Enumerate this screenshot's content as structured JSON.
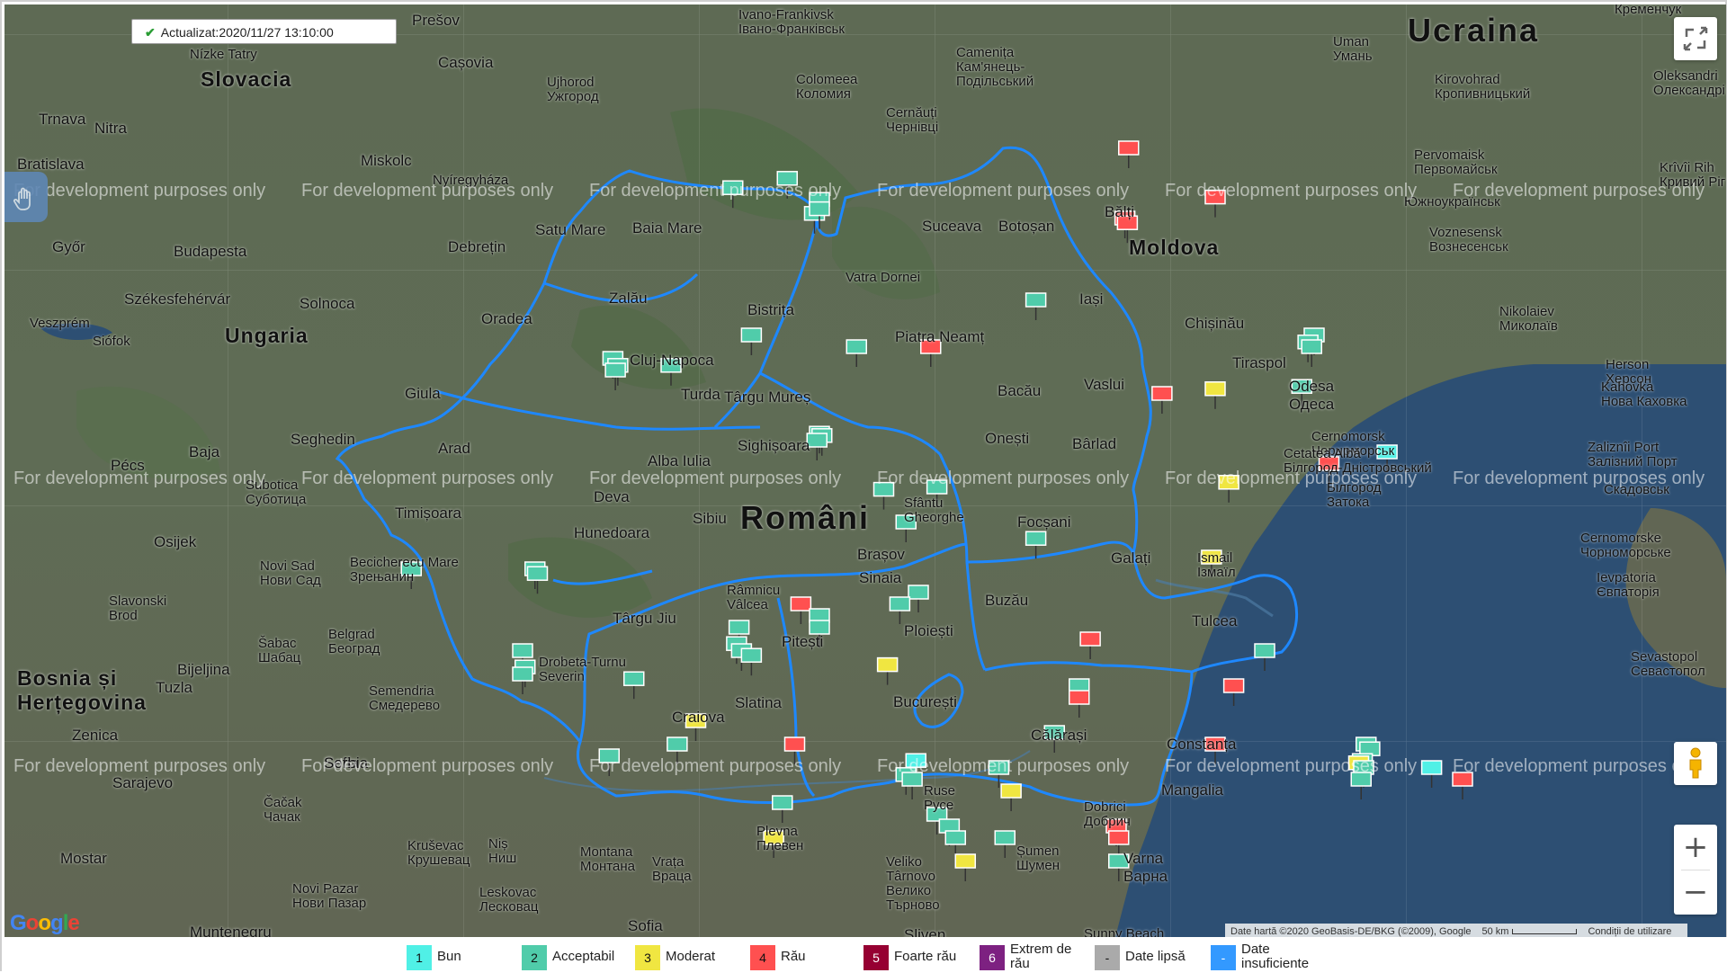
{
  "status": {
    "updated_label": "Actualizat:2020/11/27 13:10:00"
  },
  "watermark": "For development purposes only",
  "map": {
    "countries": [
      {
        "id": "ucraina",
        "name": "Ucraina"
      },
      {
        "id": "slovacia",
        "name": "Slovacia"
      },
      {
        "id": "moldova",
        "name": "Moldova"
      },
      {
        "id": "ungaria",
        "name": "Ungaria"
      },
      {
        "id": "romania",
        "name": "Români"
      },
      {
        "id": "bosnia",
        "name": "Bosnia și Herțegovina"
      },
      {
        "id": "sofia",
        "name": "Sofia"
      }
    ],
    "cities": [
      {
        "id": "presov",
        "name": "Prešov"
      },
      {
        "id": "ivano",
        "name": "Ivano-Frankivsk\nІвано-Франківськ"
      },
      {
        "id": "kremenciuc",
        "name": "Кременчук"
      },
      {
        "id": "uman",
        "name": "Uman\nУмань"
      },
      {
        "id": "nizke",
        "name": "Nízke Tatry"
      },
      {
        "id": "kosice",
        "name": "Cașovia"
      },
      {
        "id": "ujhorod",
        "name": "Ujhorod\nУжгород"
      },
      {
        "id": "colomeea",
        "name": "Colomeea\nКоломия"
      },
      {
        "id": "camenita",
        "name": "Camenița\nКам'янець-\nПодільський"
      },
      {
        "id": "kirovohrad",
        "name": "Kirovohrad\nКропивницький"
      },
      {
        "id": "oleksandria",
        "name": "Oleksandri\nОлександрі"
      },
      {
        "id": "trnava",
        "name": "Trnava"
      },
      {
        "id": "nitra",
        "name": "Nitra"
      },
      {
        "id": "bratislava",
        "name": "Bratislava"
      },
      {
        "id": "miskolc",
        "name": "Miskolc"
      },
      {
        "id": "nagyeszes",
        "name": "Nyíregyháza"
      },
      {
        "id": "cernauti",
        "name": "Cernăuți\nЧернівці"
      },
      {
        "id": "pervomaisk",
        "name": "Pervomaisk\nПервомайськ"
      },
      {
        "id": "kryvyi",
        "name": "Krîvîi Rih\nКривий Ріг"
      },
      {
        "id": "gyor",
        "name": "Győr"
      },
      {
        "id": "budapesta",
        "name": "Budapesta"
      },
      {
        "id": "debretin",
        "name": "Debrețin"
      },
      {
        "id": "satumare",
        "name": "Satu Mare"
      },
      {
        "id": "baiamare",
        "name": "Baia Mare"
      },
      {
        "id": "suceava",
        "name": "Suceava"
      },
      {
        "id": "botosan",
        "name": "Botoșan"
      },
      {
        "id": "balti",
        "name": "Bălți"
      },
      {
        "id": "iuzhnouk",
        "name": "Южноукраїнськ"
      },
      {
        "id": "voznesensk",
        "name": "Voznesensk\nВознесенськ"
      },
      {
        "id": "szekes",
        "name": "Székesfehérvár"
      },
      {
        "id": "solnoca",
        "name": "Solnoca"
      },
      {
        "id": "oradea",
        "name": "Oradea"
      },
      {
        "id": "zalau",
        "name": "Zalău"
      },
      {
        "id": "bistrita",
        "name": "Bistrița"
      },
      {
        "id": "vatra",
        "name": "Vatra Dornei"
      },
      {
        "id": "piatra",
        "name": "Piatra Neamț"
      },
      {
        "id": "iasi",
        "name": "Iași"
      },
      {
        "id": "chisinau",
        "name": "Chișinău"
      },
      {
        "id": "nikolaiev",
        "name": "Nikolaiev\nМиколаїв"
      },
      {
        "id": "veszprem",
        "name": "Veszprém"
      },
      {
        "id": "siofok",
        "name": "Siófok"
      },
      {
        "id": "cluj",
        "name": "Cluj-Napoca"
      },
      {
        "id": "targumures",
        "name": "Târgu Mureș"
      },
      {
        "id": "turda",
        "name": "Turda"
      },
      {
        "id": "bacau",
        "name": "Bacău"
      },
      {
        "id": "vaslui",
        "name": "Vaslui"
      },
      {
        "id": "tiraspol",
        "name": "Tiraspol"
      },
      {
        "id": "herson",
        "name": "Herson\nХерсон"
      },
      {
        "id": "kahovka",
        "name": "Kahovka\nНова Каховка"
      },
      {
        "id": "szeged",
        "name": "Seghedin"
      },
      {
        "id": "giula",
        "name": "Giula"
      },
      {
        "id": "baja",
        "name": "Baja"
      },
      {
        "id": "odesa",
        "name": "Odesa\nОдеса"
      },
      {
        "id": "cernomorsk",
        "name": "Cernomorsk\nЧорноморськ"
      },
      {
        "id": "onesti",
        "name": "Onești"
      },
      {
        "id": "barlad",
        "name": "Bârlad"
      },
      {
        "id": "pecs",
        "name": "Pécs"
      },
      {
        "id": "subotica",
        "name": "Subotica\nСуботица"
      },
      {
        "id": "arad",
        "name": "Arad"
      },
      {
        "id": "alba",
        "name": "Alba Iulia"
      },
      {
        "id": "sighisoara",
        "name": "Sighișoara"
      },
      {
        "id": "cetatea",
        "name": "Cetatea Albă\nБілгород-Дністровський"
      },
      {
        "id": "zaliznyi",
        "name": "Zaliznîi Port\nЗалізний Порт"
      },
      {
        "id": "skadovsk",
        "name": "Скадовськ"
      },
      {
        "id": "timisoara",
        "name": "Timișoara"
      },
      {
        "id": "deva",
        "name": "Deva"
      },
      {
        "id": "sibiu",
        "name": "Sibiu"
      },
      {
        "id": "sfantu",
        "name": "Sfântu\nGheorghe"
      },
      {
        "id": "focsani",
        "name": "Focșani"
      },
      {
        "id": "bilhorod",
        "name": "Білгород\nЗатока"
      },
      {
        "id": "osijek",
        "name": "Osijek"
      },
      {
        "id": "hunedoara",
        "name": "Hunedoara"
      },
      {
        "id": "brasov",
        "name": "Brașov"
      },
      {
        "id": "galati",
        "name": "Galați"
      },
      {
        "id": "izmail",
        "name": "Ismail\nІзмаїл"
      },
      {
        "id": "cernomorske",
        "name": "Cernomorske\nЧорноморське"
      },
      {
        "id": "novisad",
        "name": "Novi Sad\nНови Сад"
      },
      {
        "id": "zrenjanin",
        "name": "Becicherecu Mare\nЗрењанин"
      },
      {
        "id": "sinaia",
        "name": "Sinaia"
      },
      {
        "id": "ramnicu",
        "name": "Râmnicu\nVâlcea"
      },
      {
        "id": "buzau",
        "name": "Buzău"
      },
      {
        "id": "tulcea",
        "name": "Tulcea"
      },
      {
        "id": "evpatoria",
        "name": "Ievpatoria\nЄвпаторія"
      },
      {
        "id": "slavonski",
        "name": "Slavonski\nBrod"
      },
      {
        "id": "targujiu",
        "name": "Târgu Jiu"
      },
      {
        "id": "pitesti",
        "name": "Pitești"
      },
      {
        "id": "ploiesti",
        "name": "Ploiești"
      },
      {
        "id": "sabac",
        "name": "Šabac\nШабац"
      },
      {
        "id": "belgrad",
        "name": "Belgrad\nБеоград"
      },
      {
        "id": "drobeta",
        "name": "Drobeta-Turnu\nSeverin"
      },
      {
        "id": "sevastopol",
        "name": "Sevastopol\nСевастопол"
      },
      {
        "id": "bijeljina",
        "name": "Bijeljina"
      },
      {
        "id": "tuzla",
        "name": "Tuzla"
      },
      {
        "id": "craiova",
        "name": "Craiova"
      },
      {
        "id": "slatina",
        "name": "Slatina"
      },
      {
        "id": "bucuresti",
        "name": "București"
      },
      {
        "id": "calarasi",
        "name": "Călărași"
      },
      {
        "id": "constanta",
        "name": "Constanța"
      },
      {
        "id": "smederevo",
        "name": "Semendria\nСмедерево"
      },
      {
        "id": "zenica",
        "name": "Zenica"
      },
      {
        "id": "sarajevo",
        "name": "Sarajevo"
      },
      {
        "id": "sofia",
        "name": "Serbia"
      },
      {
        "id": "cacak",
        "name": "Čačak\nЧачак"
      },
      {
        "id": "ruse",
        "name": "Ruse\nРусе"
      },
      {
        "id": "mangalia",
        "name": "Mangalia"
      },
      {
        "id": "dobrich",
        "name": "Dobrici\nДобрич"
      },
      {
        "id": "pleven",
        "name": "Plevna\nПлевен"
      },
      {
        "id": "krusevac",
        "name": "Kruševac\nКрушевац"
      },
      {
        "id": "nis",
        "name": "Niș\nНиш"
      },
      {
        "id": "montana",
        "name": "Montana\nМонтана"
      },
      {
        "id": "vratsa",
        "name": "Vrața\nВраца"
      },
      {
        "id": "tarnovo",
        "name": "Veliko\nTârnovo\nВелико\nТърново"
      },
      {
        "id": "shumen",
        "name": "Șumen\nШумен"
      },
      {
        "id": "varna",
        "name": "Varna\nВарна"
      },
      {
        "id": "mostar",
        "name": "Mostar"
      },
      {
        "id": "novipazar",
        "name": "Novi Pazar\nНови Пазар"
      },
      {
        "id": "leskovac",
        "name": "Leskovac\nЛесковац"
      },
      {
        "id": "sofia2",
        "name": "Sofia"
      },
      {
        "id": "muntenegru",
        "name": "Muntenegru"
      },
      {
        "id": "sliven",
        "name": "Sliven"
      },
      {
        "id": "sunnybeach",
        "name": "Sunny Beach"
      }
    ],
    "stations": [
      {
        "q": 2,
        "lat": 47.83,
        "lon": 22.9
      },
      {
        "q": 2,
        "lat": 47.87,
        "lon": 23.34
      },
      {
        "q": 2,
        "lat": 47.78,
        "lon": 23.6
      },
      {
        "q": 2,
        "lat": 47.72,
        "lon": 23.56
      },
      {
        "q": 2,
        "lat": 47.74,
        "lon": 23.6
      },
      {
        "q": 4,
        "lat": 48.0,
        "lon": 26.1
      },
      {
        "q": 4,
        "lat": 47.79,
        "lon": 26.8
      },
      {
        "q": 4,
        "lat": 47.7,
        "lon": 26.07
      },
      {
        "q": 4,
        "lat": 47.68,
        "lon": 26.09
      },
      {
        "q": 2,
        "lat": 47.35,
        "lon": 25.35
      },
      {
        "q": 2,
        "lat": 47.2,
        "lon": 27.6
      },
      {
        "q": 2,
        "lat": 47.17,
        "lon": 27.55
      },
      {
        "q": 2,
        "lat": 47.15,
        "lon": 27.58
      },
      {
        "q": 2,
        "lat": 47.1,
        "lon": 21.93
      },
      {
        "q": 2,
        "lat": 47.07,
        "lon": 21.97
      },
      {
        "q": 2,
        "lat": 47.05,
        "lon": 21.95
      },
      {
        "q": 2,
        "lat": 47.07,
        "lon": 22.4
      },
      {
        "q": 2,
        "lat": 47.2,
        "lon": 23.05
      },
      {
        "q": 2,
        "lat": 47.15,
        "lon": 23.9
      },
      {
        "q": 4,
        "lat": 47.15,
        "lon": 24.5
      },
      {
        "q": 4,
        "lat": 46.95,
        "lon": 26.37
      },
      {
        "q": 3,
        "lat": 46.97,
        "lon": 26.8
      },
      {
        "q": 2,
        "lat": 46.98,
        "lon": 27.5
      },
      {
        "q": 2,
        "lat": 46.78,
        "lon": 23.6
      },
      {
        "q": 2,
        "lat": 46.77,
        "lon": 23.62
      },
      {
        "q": 2,
        "lat": 46.75,
        "lon": 23.58
      },
      {
        "q": 4,
        "lat": 46.65,
        "lon": 27.72
      },
      {
        "q": 1,
        "lat": 46.7,
        "lon": 28.19
      },
      {
        "q": 3,
        "lat": 46.57,
        "lon": 26.91
      },
      {
        "q": 2,
        "lat": 46.55,
        "lon": 24.55
      },
      {
        "q": 2,
        "lat": 46.54,
        "lon": 24.12
      },
      {
        "q": 2,
        "lat": 46.4,
        "lon": 24.3
      },
      {
        "q": 2,
        "lat": 46.33,
        "lon": 25.35
      },
      {
        "q": 3,
        "lat": 46.25,
        "lon": 26.77
      },
      {
        "q": 2,
        "lat": 46.2,
        "lon": 21.3
      },
      {
        "q": 2,
        "lat": 46.18,
        "lon": 21.32
      },
      {
        "q": 2,
        "lat": 46.2,
        "lon": 20.3
      },
      {
        "q": 2,
        "lat": 46.1,
        "lon": 24.4
      },
      {
        "q": 2,
        "lat": 46.05,
        "lon": 24.25
      },
      {
        "q": 4,
        "lat": 46.05,
        "lon": 23.45
      },
      {
        "q": 2,
        "lat": 46.0,
        "lon": 23.6
      },
      {
        "q": 2,
        "lat": 45.95,
        "lon": 23.6
      },
      {
        "q": 2,
        "lat": 45.95,
        "lon": 22.95
      },
      {
        "q": 2,
        "lat": 45.88,
        "lon": 22.93
      },
      {
        "q": 2,
        "lat": 45.85,
        "lon": 22.97
      },
      {
        "q": 2,
        "lat": 45.83,
        "lon": 23.05
      },
      {
        "q": 4,
        "lat": 45.9,
        "lon": 25.79
      },
      {
        "q": 3,
        "lat": 45.79,
        "lon": 24.15
      },
      {
        "q": 2,
        "lat": 45.85,
        "lon": 27.2
      },
      {
        "q": 2,
        "lat": 45.85,
        "lon": 21.2
      },
      {
        "q": 2,
        "lat": 45.78,
        "lon": 21.22
      },
      {
        "q": 2,
        "lat": 45.75,
        "lon": 21.2
      },
      {
        "q": 2,
        "lat": 45.73,
        "lon": 22.1
      },
      {
        "q": 2,
        "lat": 45.7,
        "lon": 25.7
      },
      {
        "q": 4,
        "lat": 45.65,
        "lon": 25.7
      },
      {
        "q": 4,
        "lat": 45.7,
        "lon": 26.95
      },
      {
        "q": 3,
        "lat": 45.55,
        "lon": 22.6
      },
      {
        "q": 2,
        "lat": 45.45,
        "lon": 22.45
      },
      {
        "q": 2,
        "lat": 45.4,
        "lon": 21.9
      },
      {
        "q": 4,
        "lat": 45.45,
        "lon": 23.4
      },
      {
        "q": 2,
        "lat": 45.5,
        "lon": 25.5
      },
      {
        "q": 4,
        "lat": 45.45,
        "lon": 26.8
      },
      {
        "q": 2,
        "lat": 45.45,
        "lon": 28.02
      },
      {
        "q": 2,
        "lat": 45.43,
        "lon": 28.05
      },
      {
        "q": 2,
        "lat": 45.38,
        "lon": 27.99
      },
      {
        "q": 3,
        "lat": 45.37,
        "lon": 27.96
      },
      {
        "q": 2,
        "lat": 45.35,
        "lon": 28.0
      },
      {
        "q": 2,
        "lat": 45.3,
        "lon": 27.98
      },
      {
        "q": 1,
        "lat": 45.35,
        "lon": 28.55
      },
      {
        "q": 4,
        "lat": 45.3,
        "lon": 28.8
      },
      {
        "q": 2,
        "lat": 45.35,
        "lon": 25.05
      },
      {
        "q": 1,
        "lat": 45.38,
        "lon": 24.38
      },
      {
        "q": 2,
        "lat": 45.32,
        "lon": 24.3
      },
      {
        "q": 2,
        "lat": 45.3,
        "lon": 24.35
      },
      {
        "q": 3,
        "lat": 45.25,
        "lon": 25.15
      },
      {
        "q": 2,
        "lat": 45.2,
        "lon": 23.3
      },
      {
        "q": 2,
        "lat": 45.15,
        "lon": 24.55
      },
      {
        "q": 2,
        "lat": 45.1,
        "lon": 24.65
      },
      {
        "q": 2,
        "lat": 45.05,
        "lon": 24.7
      },
      {
        "q": 3,
        "lat": 44.95,
        "lon": 24.78
      },
      {
        "q": 3,
        "lat": 45.05,
        "lon": 23.23
      },
      {
        "q": 2,
        "lat": 45.05,
        "lon": 25.1
      },
      {
        "q": 4,
        "lat": 45.1,
        "lon": 26.0
      },
      {
        "q": 4,
        "lat": 45.05,
        "lon": 26.02
      },
      {
        "q": 2,
        "lat": 44.95,
        "lon": 26.02
      },
      {
        "q": 0,
        "lat": 44.65,
        "lon": 22.4
      },
      {
        "q": 4,
        "lat": 44.63,
        "lon": 22.9
      },
      {
        "q": 2,
        "lat": 44.65,
        "lon": 23.55
      },
      {
        "q": 1,
        "lat": 44.55,
        "lon": 26.1
      },
      {
        "q": 1,
        "lat": 44.45,
        "lon": 26.05
      },
      {
        "q": 1,
        "lat": 44.42,
        "lon": 26.15
      },
      {
        "q": 1,
        "lat": 44.4,
        "lon": 26.1
      },
      {
        "q": 1,
        "lat": 44.38,
        "lon": 26.08
      },
      {
        "q": 1,
        "lat": 44.35,
        "lon": 26.02
      },
      {
        "q": 1,
        "lat": 44.65,
        "lon": 27.0
      },
      {
        "q": 4,
        "lat": 44.55,
        "lon": 27.7
      },
      {
        "q": 3,
        "lat": 44.33,
        "lon": 23.8
      },
      {
        "q": 2,
        "lat": 44.3,
        "lon": 23.85
      },
      {
        "q": 4,
        "lat": 44.3,
        "lon": 23.9
      },
      {
        "q": 4,
        "lat": 44.4,
        "lon": 24.4
      },
      {
        "q": 4,
        "lat": 44.2,
        "lon": 28.5
      },
      {
        "q": 3,
        "lat": 44.25,
        "lon": 28.87
      },
      {
        "q": 2,
        "lat": 44.2,
        "lon": 28.9
      },
      {
        "q": 2,
        "lat": 44.17,
        "lon": 28.88
      },
      {
        "q": 2,
        "lat": 44.15,
        "lon": 28.87
      },
      {
        "q": 5,
        "lat": 44.2,
        "lon": 27.32
      },
      {
        "q": 1,
        "lat": 44.2,
        "lon": 27.35
      },
      {
        "q": 2,
        "lat": 43.95,
        "lon": 22.9
      },
      {
        "q": 1,
        "lat": 43.95,
        "lon": 25.1
      },
      {
        "q": 2,
        "lat": 43.92,
        "lon": 25.9
      },
      {
        "q": 2,
        "lat": 43.88,
        "lon": 25.87
      },
      {
        "q": 1,
        "lat": 43.8,
        "lon": 28.6
      },
      {
        "q": 1,
        "lat": 43.75,
        "lon": 24.45
      },
      {
        "q": 2,
        "lat": 43.77,
        "lon": 24.4
      },
      {
        "q": 1,
        "lat": 43.65,
        "lon": 25.12
      }
    ]
  },
  "controls": {
    "zoom_in": "+",
    "zoom_out": "−"
  },
  "google_logo": [
    "G",
    "o",
    "o",
    "g",
    "l",
    "e"
  ],
  "attribution": {
    "data": "Date hartă ©2020 GeoBasis-DE/BKG (©2009), Google",
    "scale": "50 km",
    "terms": "Condiții de utilizare"
  },
  "legend": [
    {
      "id": "bun",
      "num": "1",
      "label": "Bun",
      "color": "#50f0e6"
    },
    {
      "id": "acceptabil",
      "num": "2",
      "label": "Acceptabil",
      "color": "#50ccaa"
    },
    {
      "id": "moderat",
      "num": "3",
      "label": "Moderat",
      "color": "#f0e641"
    },
    {
      "id": "rau",
      "num": "4",
      "label": "Rău",
      "color": "#ff5050"
    },
    {
      "id": "foarte-rau",
      "num": "5",
      "label": "Foarte rău",
      "color": "#960032"
    },
    {
      "id": "extrem-de-rau",
      "num": "6",
      "label": "Extrem de\nrău",
      "color": "#7d2181"
    },
    {
      "id": "date-lipsa",
      "num": "-",
      "label": "Date lipsă",
      "color": "#aaaaaa"
    },
    {
      "id": "date-insuficiente",
      "num": "-",
      "label": "Date\ninsuficiente",
      "color": "#3399ff"
    }
  ],
  "colors": {
    "romania_border": "#1e88ff",
    "water": "#2d4f73",
    "land": "#5f6b55"
  }
}
